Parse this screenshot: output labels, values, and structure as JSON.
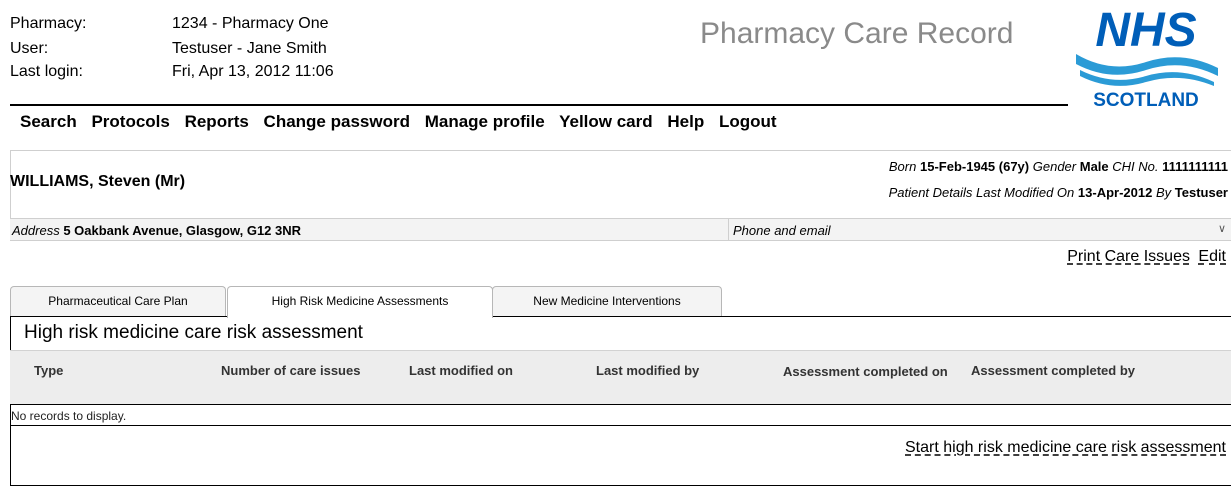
{
  "header": {
    "pharmacy_label": "Pharmacy:",
    "pharmacy_value": "1234 - Pharmacy One",
    "user_label": "User:",
    "user_value": "Testuser - Jane Smith",
    "last_login_label": "Last login:",
    "last_login_value": "Fri, Apr 13, 2012 11:06",
    "app_title": "Pharmacy Care Record",
    "logo_top": "NHS",
    "logo_bottom": "SCOTLAND",
    "logo_color": "#005eb8"
  },
  "nav": [
    "Search",
    "Protocols",
    "Reports",
    "Change password",
    "Manage profile",
    "Yellow card",
    "Help",
    "Logout"
  ],
  "patient": {
    "name": "WILLIAMS, Steven (Mr)",
    "born_label": "Born",
    "born_value": "15-Feb-1945",
    "age": "(67y)",
    "gender_label": "Gender",
    "gender_value": "Male",
    "chi_label": "CHI No.",
    "chi_value": "1111111111",
    "modified_label": "Patient Details Last Modified On",
    "modified_value": "13-Apr-2012",
    "by_label": "By",
    "by_value": "Testuser",
    "address_label": "Address",
    "address_value": "5 Oakbank Avenue, Glasgow, G12 3NR",
    "phone_label": "Phone and email",
    "expand_icon": "chevron-down-icon"
  },
  "actions": {
    "print": "Print Care Issues",
    "edit": "Edit"
  },
  "tabs": [
    {
      "label": "Pharmaceutical Care Plan",
      "active": false
    },
    {
      "label": "High Risk Medicine Assessments",
      "active": true
    },
    {
      "label": "New Medicine Interventions",
      "active": false
    }
  ],
  "panel": {
    "title": "High risk medicine care risk assessment",
    "columns": [
      "Type",
      "Number of care issues",
      "Last modified on",
      "Last modified by",
      "Assessment completed on",
      "Assessment completed by"
    ],
    "empty_message": "No records to display.",
    "start_link": "Start high risk medicine care risk assessment"
  }
}
